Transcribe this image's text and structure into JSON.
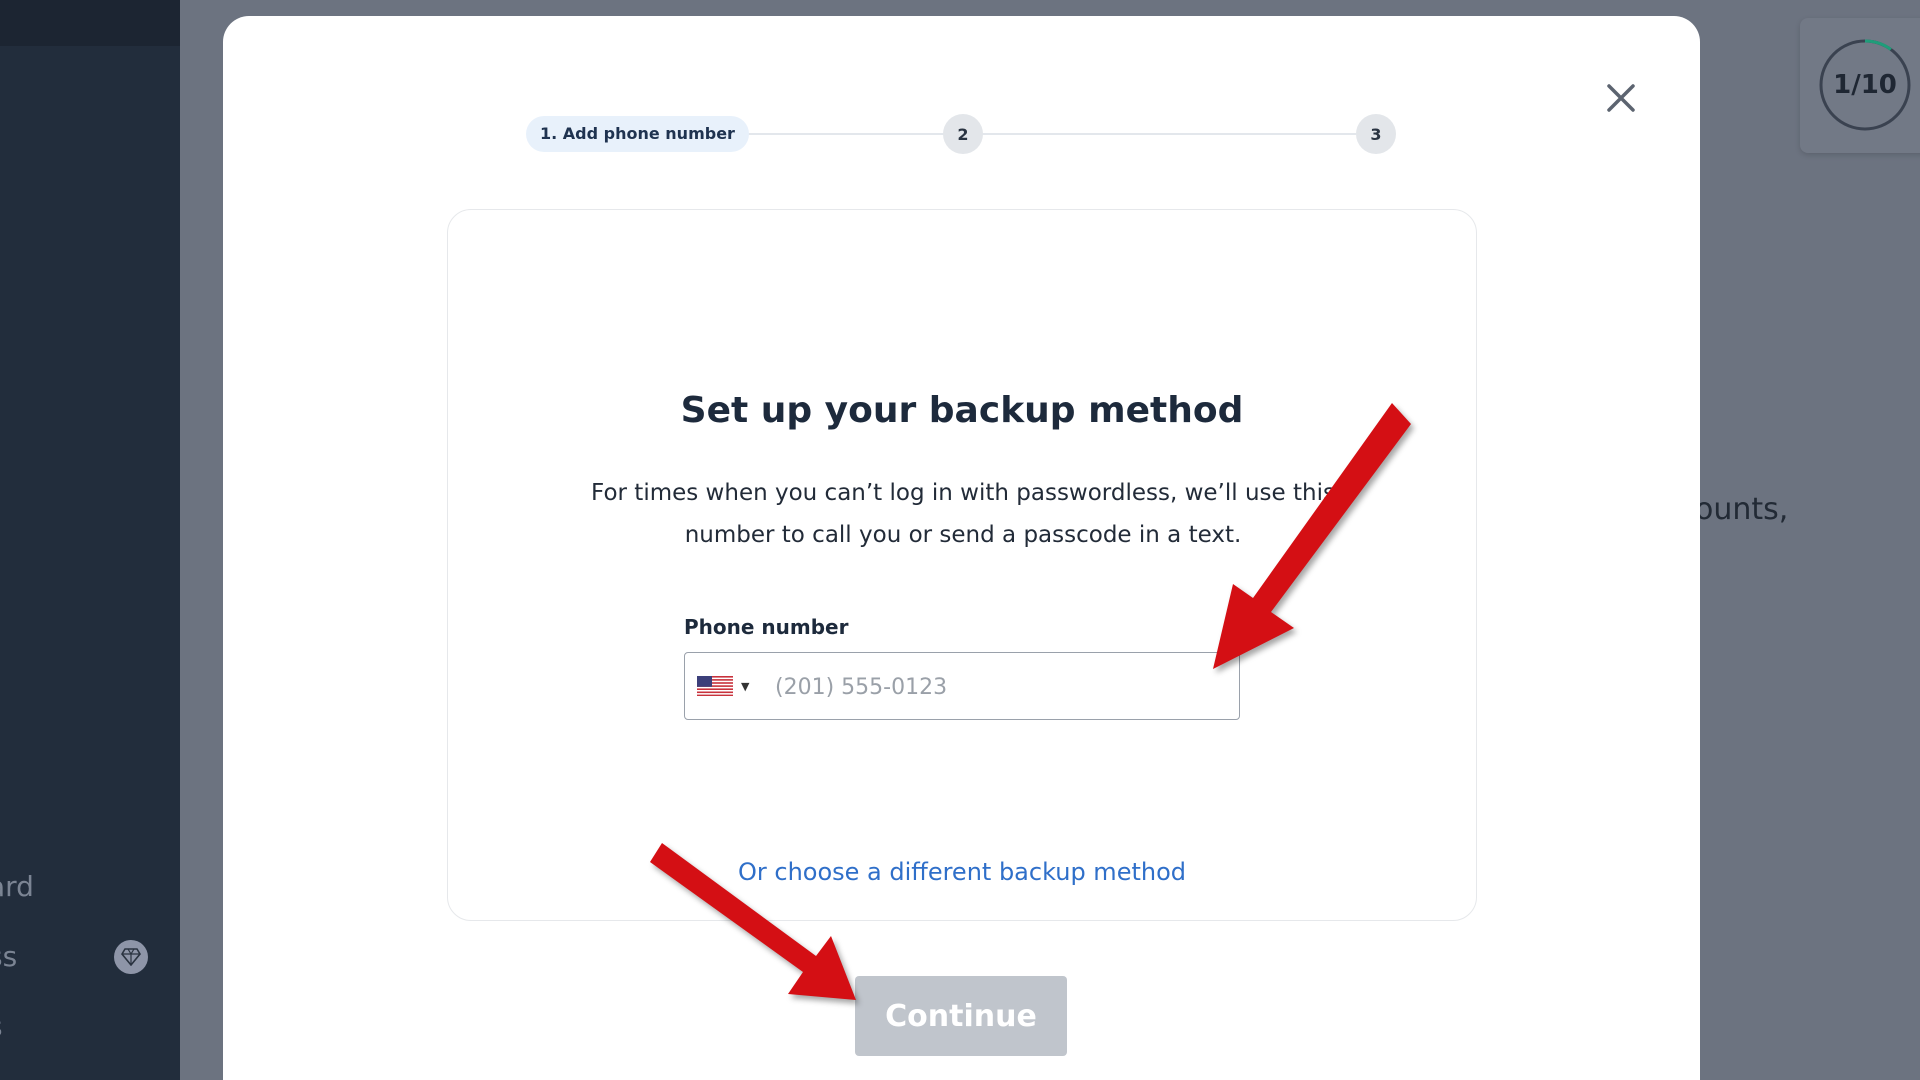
{
  "background": {
    "sidebar_items": [
      "ard",
      "ss",
      "s"
    ],
    "partial_text": "ounts,"
  },
  "progress": {
    "label": "1/10",
    "fraction": 0.1
  },
  "modal": {
    "close_icon": "close-icon",
    "steps": [
      {
        "label": "1. Add phone number",
        "active": true
      },
      {
        "label": "2",
        "active": false
      },
      {
        "label": "3",
        "active": false
      }
    ],
    "title": "Set up your backup method",
    "description": "For times when you can’t log in with passwordless, we’ll use this number to call you or send a passcode in a text.",
    "phone": {
      "label": "Phone number",
      "country_icon": "us-flag-icon",
      "value": "",
      "placeholder": "(201) 555-0123"
    },
    "alt_link": "Or choose a different backup method",
    "continue_label": "Continue"
  },
  "colors": {
    "link": "#2f6fc9",
    "button_disabled": "#c0c5cc",
    "annotation_arrow": "#d40f14"
  }
}
